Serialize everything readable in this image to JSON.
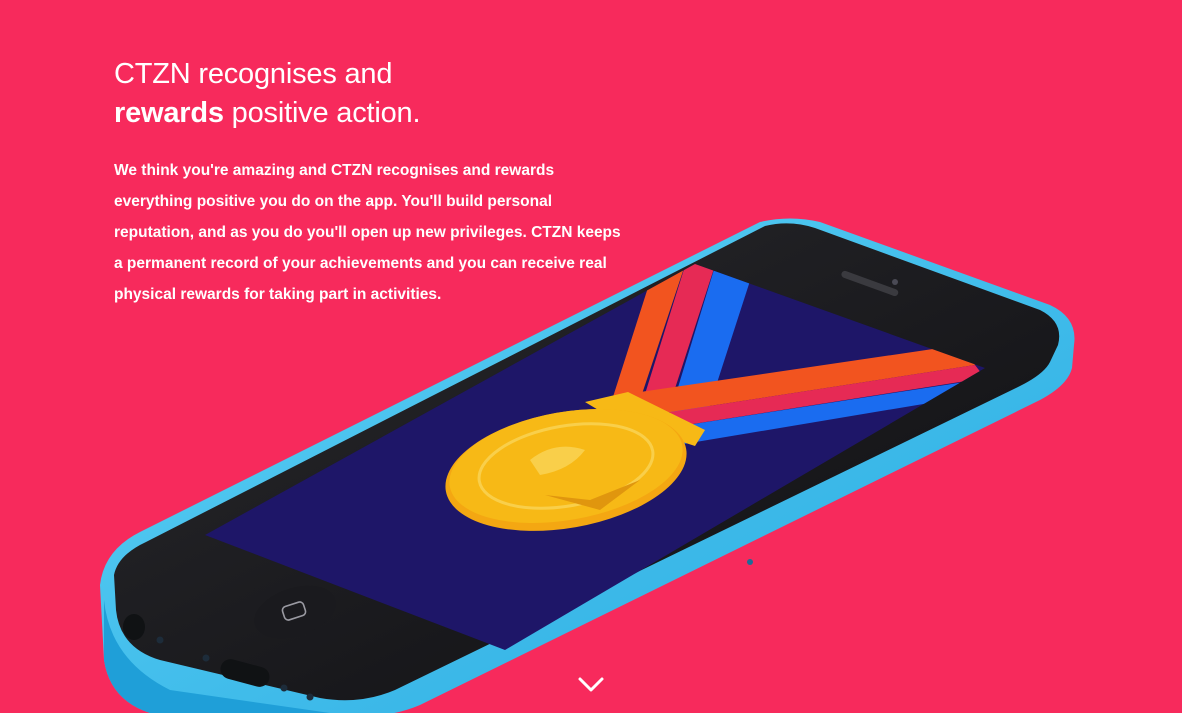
{
  "hero": {
    "headline_line1": "CTZN recognises and",
    "headline_bold": "rewards",
    "headline_rest": " positive action.",
    "paragraph": "We think you're amazing and CTZN recognises and rewards everything positive you do on the app. You'll build personal reputation, and as you do you'll open up new privileges. CTZN keeps a permanent record of your achievements and you can receive real physical rewards for taking part in activities."
  },
  "colors": {
    "background": "#f72a5c",
    "phone_body": "#3cc2f2",
    "screen": "#1e1668",
    "medal": "#f7b916",
    "ribbon_orange": "#f2541f",
    "ribbon_red": "#e62a55",
    "ribbon_blue": "#1a6cf0"
  },
  "icons": {
    "scroll": "chevron-down-icon",
    "medal": "medal-icon"
  }
}
